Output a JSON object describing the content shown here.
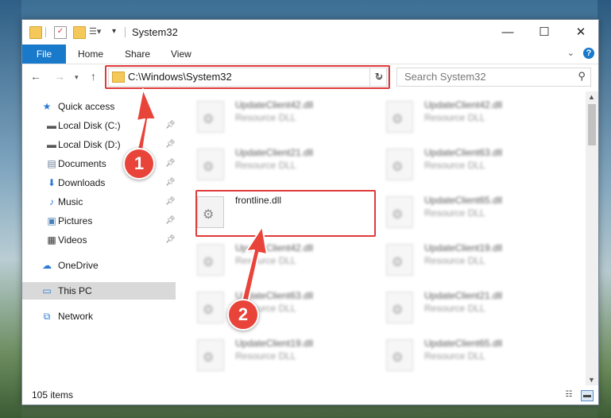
{
  "window": {
    "title": "System32"
  },
  "title_buttons": {
    "minimize": "—",
    "maximize": "☐",
    "close": "✕"
  },
  "ribbon": {
    "file": "File",
    "tabs": [
      "Home",
      "Share",
      "View"
    ]
  },
  "address": {
    "path": "C:\\Windows\\System32"
  },
  "search": {
    "placeholder": "Search System32"
  },
  "nav": {
    "quick_access": "Quick access",
    "items": [
      "Local Disk (C:)",
      "Local Disk (D:)",
      "Documents",
      "Downloads",
      "Music",
      "Pictures",
      "Videos"
    ],
    "onedrive": "OneDrive",
    "this_pc": "This PC",
    "network": "Network"
  },
  "files": [
    {
      "name": "UpdateClient42.dll",
      "type": "Resource DLL"
    },
    {
      "name": "UpdateClient42.dll",
      "type": "Resource DLL"
    },
    {
      "name": "UpdateClient21.dll",
      "type": "Resource DLL"
    },
    {
      "name": "UpdateClient63.dll",
      "type": "Resource DLL"
    },
    {
      "name": "frontline.dll",
      "type": ""
    },
    {
      "name": "UpdateClient65.dll",
      "type": "Resource DLL"
    },
    {
      "name": "UpdateClient42.dll",
      "type": "Resource DLL"
    },
    {
      "name": "UpdateClient19.dll",
      "type": "Resource DLL"
    },
    {
      "name": "UpdateClient63.dll",
      "type": "Resource DLL"
    },
    {
      "name": "UpdateClient21.dll",
      "type": "Resource DLL"
    },
    {
      "name": "UpdateClient19.dll",
      "type": "Resource DLL"
    },
    {
      "name": "UpdateClient65.dll",
      "type": "Resource DLL"
    }
  ],
  "status": {
    "count": "105 items"
  },
  "annotations": {
    "badge1": "1",
    "badge2": "2",
    "color": "#e03a3a"
  }
}
